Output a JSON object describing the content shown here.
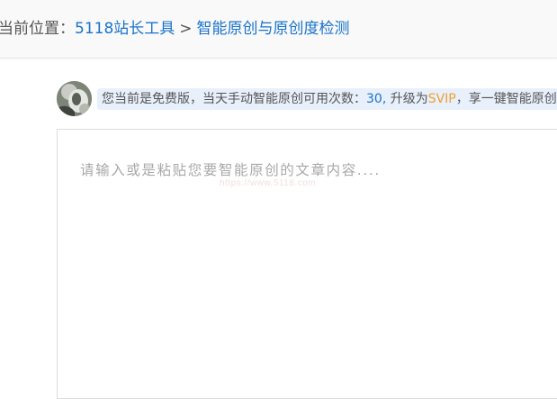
{
  "breadcrumb": {
    "prefix": "当前位置：",
    "home_link": "5118站长工具",
    "separator": ">",
    "current_link": "智能原创与原创度检测"
  },
  "notice": {
    "text_before": "您当前是免费版，当天手动智能原创可用次数：",
    "count": "30,",
    "text_middle": " 升级为",
    "vip_link": "SVIP",
    "text_after": "，享一键智能原创"
  },
  "editor": {
    "placeholder": "请输入或是粘贴您要智能原创的文章内容....",
    "value": "",
    "watermark": "https://www.5118.com"
  },
  "colors": {
    "link": "#1a73c9",
    "vip": "#f0a030",
    "notice_bg": "#e8f0fb"
  },
  "icons": {
    "avatar": "user-avatar-image"
  }
}
